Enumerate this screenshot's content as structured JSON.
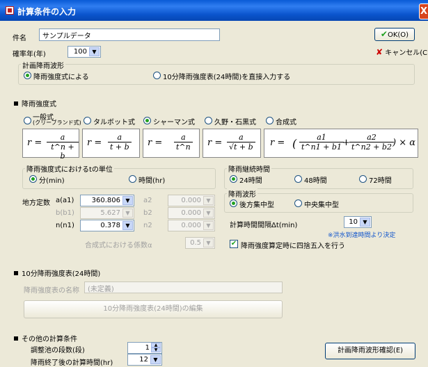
{
  "window": {
    "title": "計算条件の入力",
    "close": "X"
  },
  "name": {
    "label": "件名",
    "value": "サンプルデータ"
  },
  "prob": {
    "label": "確率年(年)",
    "value": "100"
  },
  "ok_label": "OK(O)",
  "cancel_label": "キャンセル(C)",
  "design_rain": {
    "title": "計画降雨波形",
    "opt1": "降雨強度式による",
    "opt2": "10分降雨強度表(24時間)を直接入力する"
  },
  "intensity": {
    "section": "降雨強度式",
    "types": [
      "一般式",
      "(クリーブランド式)",
      "タルボット式",
      "シャーマン式",
      "久野・石黒式",
      "合成式"
    ]
  },
  "formulas": {
    "r": "r =",
    "a": "a",
    "d1": "t^n + b",
    "d2": "t + b",
    "d3": "t^n",
    "d4": "√t + b",
    "f5_open": "(",
    "f5_n1": "a1",
    "f5_d1": "t^n1 + b1",
    "f5_plus": "+",
    "f5_n2": "a2",
    "f5_d2": "t^n2 + b2",
    "f5_close": ") × α"
  },
  "unit": {
    "title": "降雨強度式におけるtの単位",
    "min": "分(min)",
    "hr": "時間(hr)"
  },
  "duration": {
    "title": "降雨継続時間",
    "h24": "24時間",
    "h48": "48時間",
    "h72": "72時間"
  },
  "waveform": {
    "title": "降雨波形",
    "late": "後方集中型",
    "center": "中央集中型"
  },
  "constants": {
    "label": "地方定数",
    "a": "a(a1)",
    "a_val": "360.806",
    "b": "b(b1)",
    "b_val": "5.627",
    "n": "n(n1)",
    "n_val": "0.378",
    "a2": "a2",
    "a2_val": "0.000",
    "b2": "b2",
    "b2_val": "0.000",
    "n2": "n2",
    "n2_val": "0.000",
    "alpha": "合成式における係数α",
    "alpha_val": "0.5"
  },
  "interval": {
    "label": "計算時間間隔Δt(min)",
    "value": "10",
    "note": "※洪水到達時間より決定"
  },
  "rounding_label": "降雨強度算定時に四捨五入を行う",
  "table10": {
    "section": "10分降雨強度表(24時間)",
    "name_label": "降雨強度表の名称",
    "name_value": "(未定義)",
    "edit_button": "10分降雨強度表(24時間)の編集"
  },
  "other": {
    "section": "その他の計算条件",
    "stages_label": "調整池の段数(段)",
    "stages_value": "1",
    "after_label": "降雨終了後の計算時間(hr)",
    "after_value": "12",
    "confirm_button": "計画降雨波形確認(E)"
  },
  "colors": {
    "title_bar": "#0a54cc",
    "dialog_bg": "#ece9d8",
    "note_blue": "#1155cc",
    "check_green": "#21a121",
    "cancel_red": "#cc0000"
  }
}
